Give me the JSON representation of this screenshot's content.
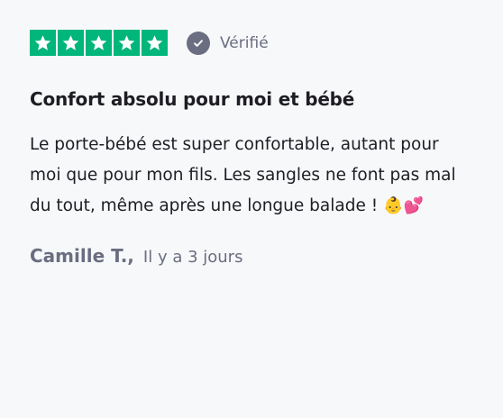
{
  "review": {
    "rating": 5,
    "rating_max": 5,
    "star_color": "#00b67a",
    "verified_icon": "check-circle-icon",
    "verified_label": "Vérifié",
    "title": "Confort absolu pour moi et bébé",
    "body": "Le porte-bébé est super confortable, autant pour moi que pour mon fils. Les sangles ne font pas mal du tout, même après une longue balade !",
    "body_emojis": "👶💕",
    "author": "Camille T.,",
    "date": "Il y a 3 jours"
  }
}
